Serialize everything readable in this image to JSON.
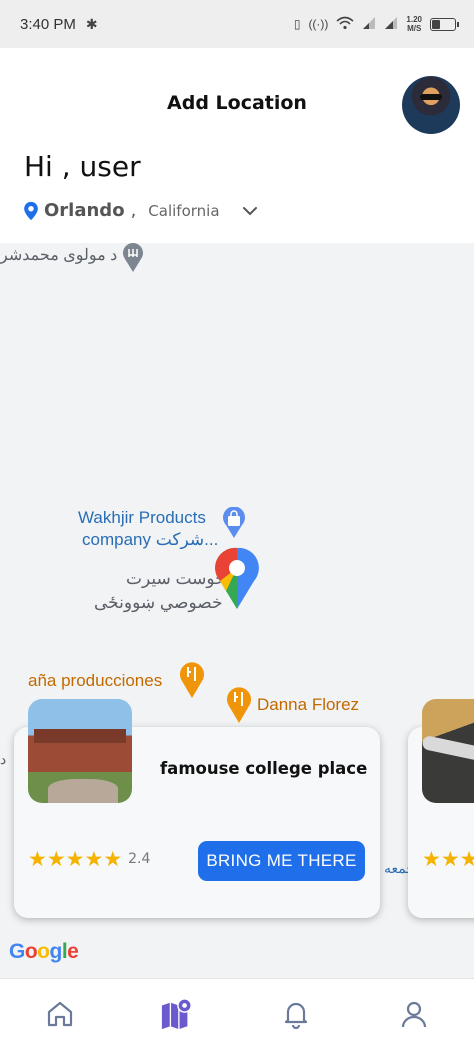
{
  "status_bar": {
    "time": "3:40 PM",
    "net_speed_value": "1.20",
    "net_speed_unit": "M/S",
    "battery_level": 0.4
  },
  "header": {
    "title": "Add Location",
    "greeting": "Hi , user",
    "location": {
      "city": "Orlando",
      "separator": ",",
      "state": "California"
    }
  },
  "map": {
    "labels": {
      "top_left": "د مولوی محمدشر",
      "wakhjir_line1": "Wakhjir Products",
      "wakhjir_line2": "company شرکت...",
      "pashto_line1": "خوست سیرت",
      "pashto_line2": "خصوصي ښوونځی",
      "producciones": "aña producciones",
      "danna": "Danna Florez",
      "edge_left": "د",
      "edge_right": "جمعه"
    },
    "google_logo": {
      "letters": [
        "G",
        "o",
        "o",
        "g",
        "l",
        "e"
      ],
      "colors": [
        "#4285F4",
        "#EA4335",
        "#FBBC05",
        "#4285F4",
        "#34A853",
        "#EA4335"
      ]
    }
  },
  "cards": [
    {
      "title": "famouse college place",
      "stars": 5,
      "rating": "2.4",
      "button_label": "BRING ME THERE"
    },
    {
      "stars": 5
    }
  ],
  "bottom_nav": {
    "items": [
      "home-icon",
      "map-icon",
      "bell-icon",
      "profile-icon"
    ],
    "active": "map-icon"
  },
  "colors": {
    "accent": "#1f6feb",
    "star": "#f5b301",
    "nav_inactive": "#6b7a99",
    "nav_active": "#6a5acd"
  }
}
